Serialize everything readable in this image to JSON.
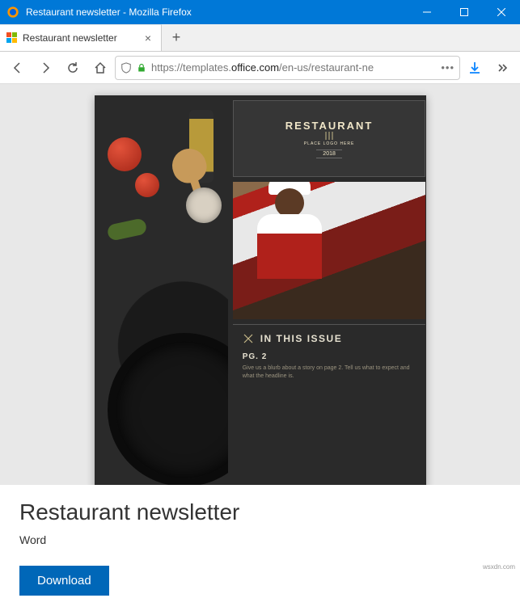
{
  "window": {
    "title": "Restaurant newsletter - Mozilla Firefox"
  },
  "tab": {
    "title": "Restaurant newsletter"
  },
  "url": {
    "protocol": "https://",
    "sub": "templates.",
    "domain": "office.com",
    "path": "/en-us/restaurant-ne"
  },
  "preview": {
    "logo_title": "RESTAURANT",
    "logo_tag": "PLACE LOGO HERE",
    "logo_year": "2018",
    "issue_heading": "IN THIS ISSUE",
    "pg_label": "PG. 2",
    "blurb": "Give us a blurb about a story on page 2. Tell us what to expect and what the headline is."
  },
  "detail": {
    "title": "Restaurant newsletter",
    "category": "Word",
    "download_label": "Download"
  },
  "watermark": "wsxdn.com"
}
